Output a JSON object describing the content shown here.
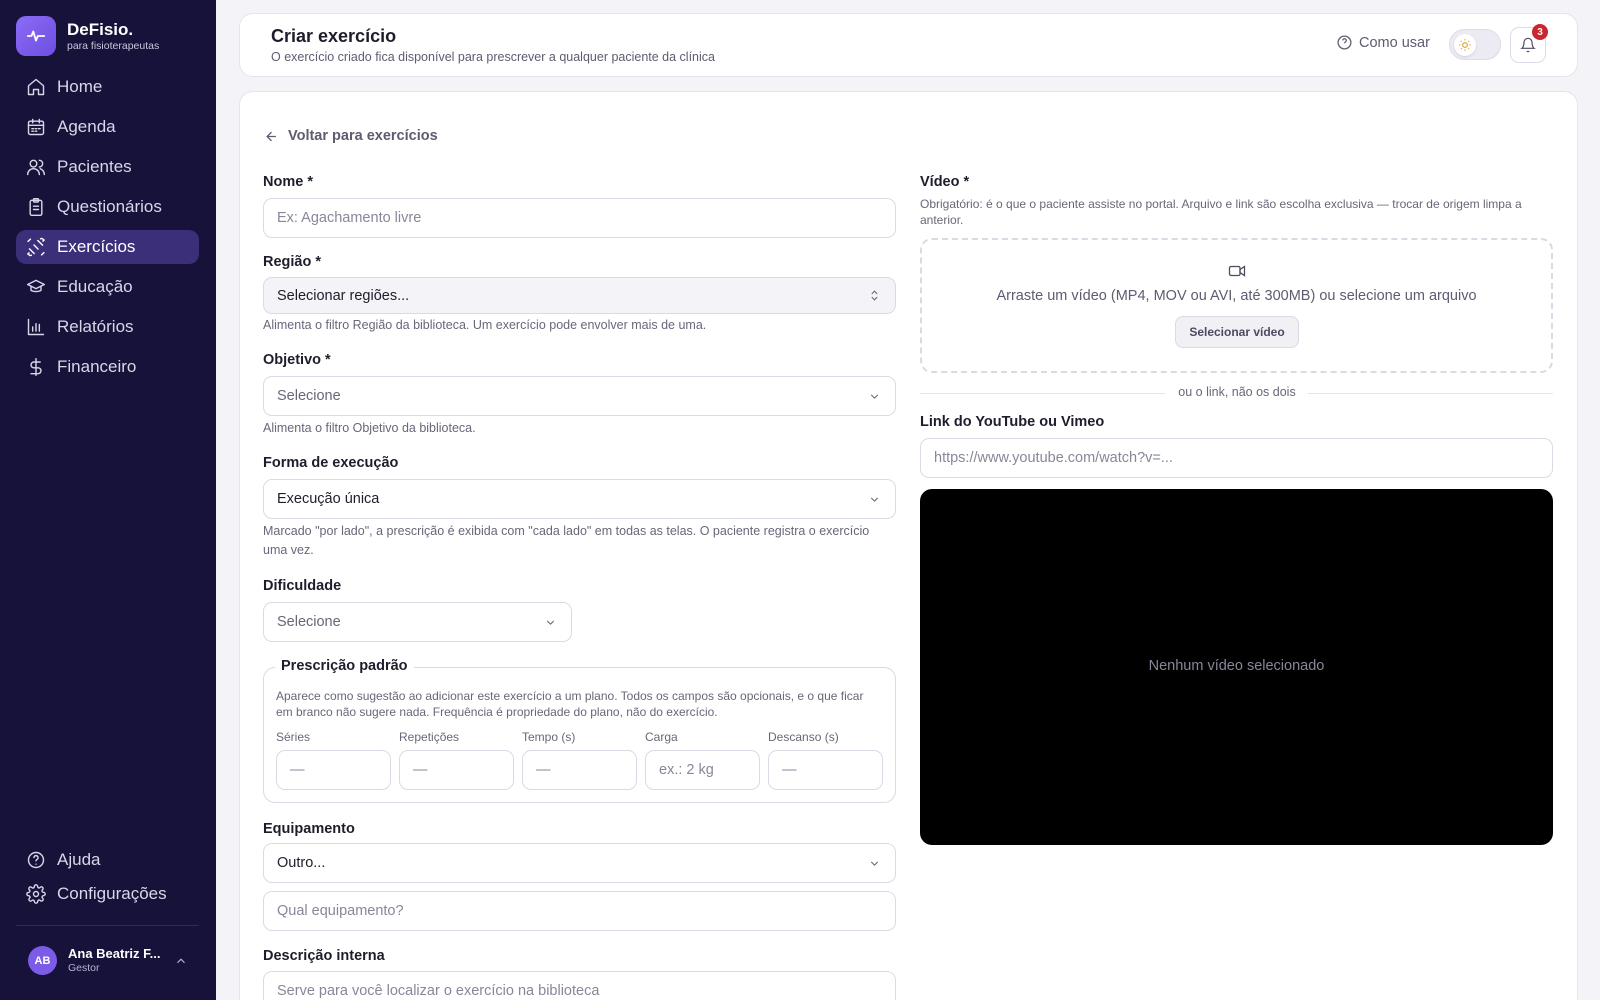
{
  "brand": {
    "name": "DeFisio.",
    "subtitle": "para fisioterapeutas"
  },
  "nav": {
    "items": [
      {
        "label": "Home",
        "icon": "home-icon"
      },
      {
        "label": "Agenda",
        "icon": "calendar-icon"
      },
      {
        "label": "Pacientes",
        "icon": "users-icon"
      },
      {
        "label": "Questionários",
        "icon": "clipboard-icon"
      },
      {
        "label": "Exercícios",
        "icon": "dumbbell-icon",
        "active": true
      },
      {
        "label": "Educação",
        "icon": "graduation-cap-icon"
      },
      {
        "label": "Relatórios",
        "icon": "bar-chart-icon"
      },
      {
        "label": "Financeiro",
        "icon": "dollar-icon"
      }
    ],
    "bottom": [
      {
        "label": "Ajuda",
        "icon": "help-circle-icon"
      },
      {
        "label": "Configurações",
        "icon": "gear-icon"
      }
    ]
  },
  "user": {
    "initials": "AB",
    "name": "Ana Beatriz F...",
    "role": "Gestor"
  },
  "header": {
    "title": "Criar exercício",
    "subtitle": "O exercício criado fica disponível para prescrever a qualquer paciente da clínica",
    "how_to": "Como usar",
    "notification_count": "3"
  },
  "form": {
    "back": "Voltar para exercícios",
    "nome": {
      "label": "Nome *",
      "placeholder": "Ex: Agachamento livre"
    },
    "regiao": {
      "label": "Região *",
      "value": "Selecionar regiões...",
      "help": "Alimenta o filtro Região da biblioteca. Um exercício pode envolver mais de uma."
    },
    "objetivo": {
      "label": "Objetivo *",
      "value": "Selecione",
      "help": "Alimenta o filtro Objetivo da biblioteca."
    },
    "forma": {
      "label": "Forma de execução",
      "value": "Execução única",
      "help": "Marcado \"por lado\", a prescrição é exibida com \"cada lado\" em todas as telas. O paciente registra o exercício uma vez."
    },
    "dificuldade": {
      "label": "Dificuldade",
      "value": "Selecione"
    },
    "prescricao": {
      "legend": "Prescrição padrão",
      "help": "Aparece como sugestão ao adicionar este exercício a um plano. Todos os campos são opcionais, e o que ficar em branco não sugere nada. Frequência é propriedade do plano, não do exercício.",
      "fields": [
        {
          "label": "Séries",
          "placeholder": "—"
        },
        {
          "label": "Repetições",
          "placeholder": "—"
        },
        {
          "label": "Tempo (s)",
          "placeholder": "—"
        },
        {
          "label": "Carga",
          "placeholder": "ex.: 2 kg"
        },
        {
          "label": "Descanso (s)",
          "placeholder": "—"
        }
      ]
    },
    "equipamento": {
      "label": "Equipamento",
      "value": "Outro...",
      "other_placeholder": "Qual equipamento?"
    },
    "descricao": {
      "label": "Descrição interna",
      "placeholder": "Serve para você localizar o exercício na biblioteca"
    }
  },
  "video": {
    "label": "Vídeo *",
    "help": "Obrigatório: é o que o paciente assiste no portal. Arquivo e link são escolha exclusiva — trocar de origem limpa a anterior.",
    "dropzone_text": "Arraste um vídeo (MP4, MOV ou AVI, até 300MB) ou selecione um arquivo",
    "select_button": "Selecionar vídeo",
    "separator": "ou o link, não os dois",
    "link_label": "Link do YouTube ou Vimeo",
    "link_placeholder": "https://www.youtube.com/watch?v=...",
    "empty_text": "Nenhum vídeo selecionado"
  }
}
